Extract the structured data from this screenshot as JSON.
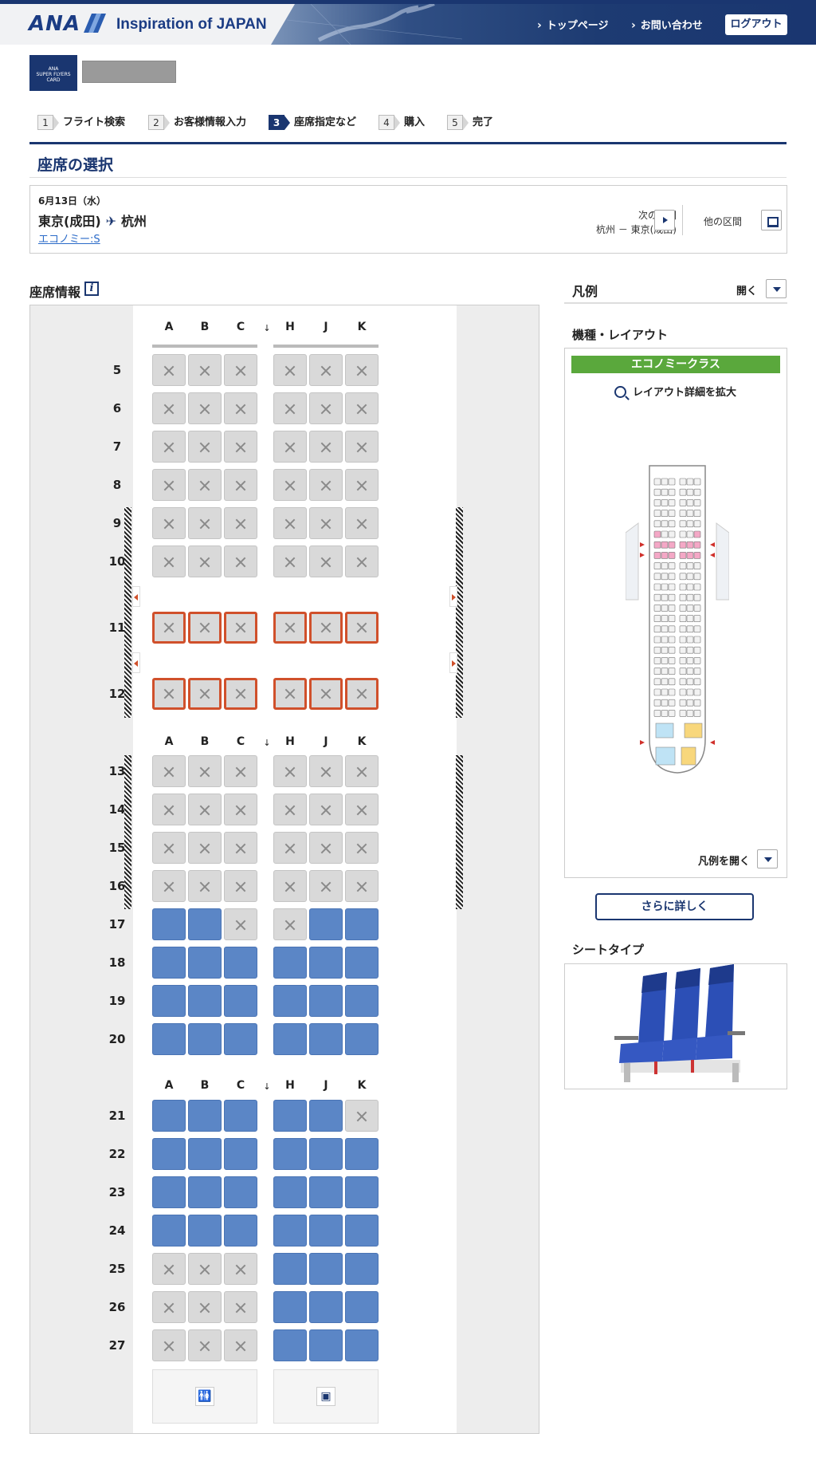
{
  "header": {
    "brand": "ANA",
    "tagline": "Inspiration of JAPAN",
    "nav_top": "トップページ",
    "nav_contact": "お問い合わせ",
    "logout": "ログアウト"
  },
  "member": {
    "card_line1": "ANA",
    "card_line2": "SUPER FLYERS CARD"
  },
  "steps": [
    {
      "num": "1",
      "label": "フライト検索"
    },
    {
      "num": "2",
      "label": "お客様情報入力"
    },
    {
      "num": "3",
      "label": "座席指定など"
    },
    {
      "num": "4",
      "label": "購入"
    },
    {
      "num": "5",
      "label": "完了"
    }
  ],
  "active_step": "3",
  "page_title": "座席の選択",
  "flight": {
    "date": "6月13日（水）",
    "origin": "東京(成田)",
    "destination": "杭州",
    "fare_class": "エコノミー:S",
    "next_segment_label": "次の区間",
    "next_segment_route": "杭州 －  東京(成田)",
    "other_segments_label": "他の区間"
  },
  "seat_info_title": "座席情報",
  "info_icon": "i",
  "seatmap": {
    "columns_left": [
      "A",
      "B",
      "C"
    ],
    "columns_right": [
      "H",
      "J",
      "K"
    ],
    "aisle_glyph": "↓",
    "rows": [
      {
        "row": "5",
        "seats": [
          "occupied",
          "occupied",
          "occupied",
          "occupied",
          "occupied",
          "occupied"
        ],
        "exit": false
      },
      {
        "row": "6",
        "seats": [
          "occupied",
          "occupied",
          "occupied",
          "occupied",
          "occupied",
          "occupied"
        ],
        "exit": false
      },
      {
        "row": "7",
        "seats": [
          "occupied",
          "occupied",
          "occupied",
          "occupied",
          "occupied",
          "occupied"
        ],
        "exit": false
      },
      {
        "row": "8",
        "seats": [
          "occupied",
          "occupied",
          "occupied",
          "occupied",
          "occupied",
          "occupied"
        ],
        "exit": false
      },
      {
        "row": "9",
        "seats": [
          "occupied",
          "occupied",
          "occupied",
          "occupied",
          "occupied",
          "occupied"
        ],
        "exit": false
      },
      {
        "row": "10",
        "seats": [
          "occupied",
          "occupied",
          "occupied",
          "occupied",
          "occupied",
          "occupied"
        ],
        "exit": false
      },
      {
        "row": "11",
        "seats": [
          "occupied",
          "occupied",
          "occupied",
          "occupied",
          "occupied",
          "occupied"
        ],
        "exit": true
      },
      {
        "row": "12",
        "seats": [
          "occupied",
          "occupied",
          "occupied",
          "occupied",
          "occupied",
          "occupied"
        ],
        "exit": true
      },
      {
        "row": "13",
        "seats": [
          "occupied",
          "occupied",
          "occupied",
          "occupied",
          "occupied",
          "occupied"
        ],
        "exit": false
      },
      {
        "row": "14",
        "seats": [
          "occupied",
          "occupied",
          "occupied",
          "occupied",
          "occupied",
          "occupied"
        ],
        "exit": false
      },
      {
        "row": "15",
        "seats": [
          "occupied",
          "occupied",
          "occupied",
          "occupied",
          "occupied",
          "occupied"
        ],
        "exit": false
      },
      {
        "row": "16",
        "seats": [
          "occupied",
          "occupied",
          "occupied",
          "occupied",
          "occupied",
          "occupied"
        ],
        "exit": false
      },
      {
        "row": "17",
        "seats": [
          "available",
          "available",
          "occupied",
          "occupied",
          "available",
          "available"
        ],
        "exit": false
      },
      {
        "row": "18",
        "seats": [
          "available",
          "available",
          "available",
          "available",
          "available",
          "available"
        ],
        "exit": false
      },
      {
        "row": "19",
        "seats": [
          "available",
          "available",
          "available",
          "available",
          "available",
          "available"
        ],
        "exit": false
      },
      {
        "row": "20",
        "seats": [
          "available",
          "available",
          "available",
          "available",
          "available",
          "available"
        ],
        "exit": false
      },
      {
        "row": "21",
        "seats": [
          "available",
          "available",
          "available",
          "available",
          "available",
          "occupied"
        ],
        "exit": false
      },
      {
        "row": "22",
        "seats": [
          "available",
          "available",
          "available",
          "available",
          "available",
          "available"
        ],
        "exit": false
      },
      {
        "row": "23",
        "seats": [
          "available",
          "available",
          "available",
          "available",
          "available",
          "available"
        ],
        "exit": false
      },
      {
        "row": "24",
        "seats": [
          "available",
          "available",
          "available",
          "available",
          "available",
          "available"
        ],
        "exit": false
      },
      {
        "row": "25",
        "seats": [
          "occupied",
          "occupied",
          "occupied",
          "available",
          "available",
          "available"
        ],
        "exit": false
      },
      {
        "row": "26",
        "seats": [
          "occupied",
          "occupied",
          "occupied",
          "available",
          "available",
          "available"
        ],
        "exit": false
      },
      {
        "row": "27",
        "seats": [
          "occupied",
          "occupied",
          "occupied",
          "available",
          "available",
          "available"
        ],
        "exit": false
      }
    ],
    "facilities": [
      {
        "name": "lavatory-icon",
        "glyph": "🚻"
      },
      {
        "name": "galley-icon",
        "glyph": "▣"
      }
    ]
  },
  "legend": {
    "title": "凡例",
    "open_label": "開く",
    "layout_title": "機種・レイアウト",
    "cabin_class": "エコノミークラス",
    "zoom_label": "レイアウト詳細を拡大",
    "open_legend_label": "凡例を開く",
    "more_button": "さらに詳しく",
    "seat_type_title": "シートタイプ"
  },
  "colors": {
    "brand_navy": "#1a3670",
    "available_seat": "#5b86c6",
    "occupied_seat": "#d9d9d9",
    "exit_row_border": "#d0502b",
    "economy_green": "#5aa83c"
  }
}
